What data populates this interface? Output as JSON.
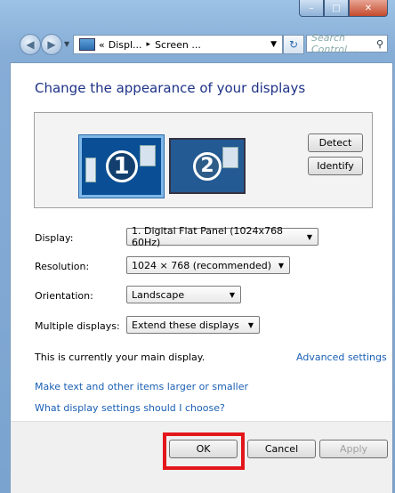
{
  "window": {
    "caption_buttons": {
      "minimize": "–",
      "maximize": "□",
      "close": "✕"
    }
  },
  "nav": {
    "breadcrumb": [
      "«",
      "Displ...",
      "▸",
      "Screen ..."
    ],
    "search_placeholder": "Search Control ..."
  },
  "main": {
    "title": "Change the appearance of your displays",
    "monitor1": "1",
    "monitor2": "2",
    "detect_label": "Detect",
    "identify_label": "Identify"
  },
  "settings": {
    "display_label": "Display:",
    "display_value": "1. Digital Flat Panel (1024x768 60Hz)",
    "resolution_label": "Resolution:",
    "resolution_value": "1024 × 768 (recommended)",
    "orientation_label": "Orientation:",
    "orientation_value": "Landscape",
    "multiple_label": "Multiple displays:",
    "multiple_value": "Extend these displays"
  },
  "info": {
    "main_display_text": "This is currently your main display.",
    "advanced_link": "Advanced settings",
    "larger_link": "Make text and other items larger or smaller",
    "which_link": "What display settings should I choose?"
  },
  "footer": {
    "ok_label": "OK",
    "cancel_label": "Cancel",
    "apply_label": "Apply"
  },
  "colors": {
    "title": "#1e3287",
    "link": "#1a5fb4",
    "highlight": "#e3161b"
  }
}
